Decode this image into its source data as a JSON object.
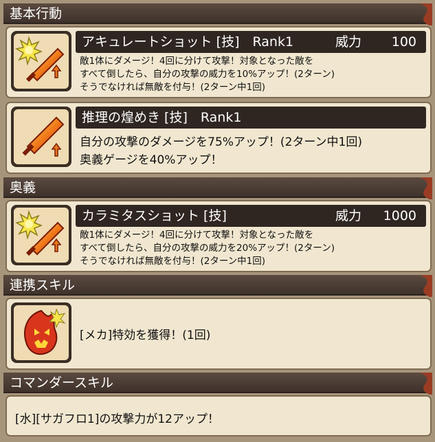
{
  "sections": {
    "basic_action": "基本行動",
    "ougi": "奥義",
    "link_skill": "連携スキル",
    "commander_skill": "コマンダースキル"
  },
  "skills": [
    {
      "title": "アキュレートショット [技]　Rank1",
      "power_label": "威力",
      "power_value": "100",
      "lines": [
        "敵1体にダメージ！4回に分けて攻撃！対象となった敵を",
        "すべて倒したら、自分の攻撃の威力を10%アップ！(2ターン)",
        "そうでなければ無敵を付与！(2ターン中1回)"
      ],
      "icon": "burst-sword-icon"
    },
    {
      "title": "推理の煌めき [技]　Rank1",
      "lines": [
        "自分の攻撃のダメージを75%アップ！(2ターン中1回)",
        "奥義ゲージを40%アップ！"
      ],
      "icon": "sword-up-icon"
    },
    {
      "title": "カラミタスショット [技]",
      "power_label": "威力",
      "power_value": "1000",
      "lines": [
        "敵1体にダメージ！4回に分けて攻撃！対象となった敵を",
        "すべて倒したら、自分の攻撃の威力を20%アップ！(2ターン)",
        "そうでなければ無敵を付与！(2ターン中1回)"
      ],
      "icon": "burst-sword-icon"
    }
  ],
  "link_skill": {
    "text": "[メカ]特効を獲得！(1回)",
    "icon": "fire-ghost-icon"
  },
  "commander_skill": {
    "text": "[水][サガフロ1]の攻撃力が12アップ！"
  },
  "colors": {
    "background": "#a7957b",
    "header": "#3f322b",
    "card": "#f1e7d0",
    "title_bar": "#2f2622",
    "accent_red": "#9a3c24"
  }
}
